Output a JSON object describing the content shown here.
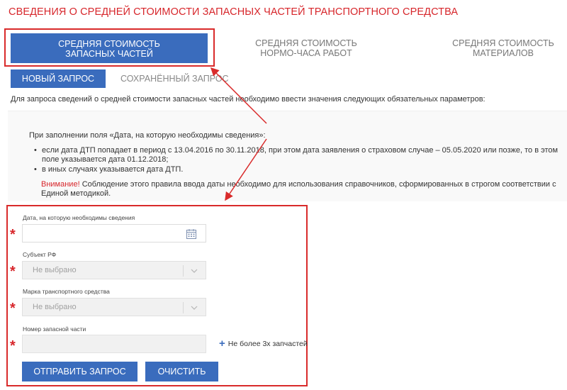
{
  "page": {
    "title": "СВЕДЕНИЯ О СРЕДНЕЙ СТОИМОСТИ ЗАПАСНЫХ ЧАСТЕЙ ТРАНСПОРТНОГО СРЕДСТВА"
  },
  "tabs": [
    {
      "line1": "СРЕДНЯЯ СТОИМОСТЬ",
      "line2": "ЗАПАСНЫХ ЧАСТЕЙ",
      "active": true
    },
    {
      "line1": "СРЕДНЯЯ СТОИМОСТЬ",
      "line2": "НОРМО-ЧАСА РАБОТ",
      "active": false
    },
    {
      "line1": "СРЕДНЯЯ СТОИМОСТЬ",
      "line2": "МАТЕРИАЛОВ",
      "active": false
    }
  ],
  "subtabs": {
    "new_request": "НОВЫЙ ЗАПРОС",
    "saved_request": "СОХРАНЁННЫЙ ЗАПРОС"
  },
  "intro": "Для запроса сведений о средней стоимости запасных частей необходимо ввести значения следующих обязательных параметров:",
  "info": {
    "heading": "При заполнении поля «Дата, на которую необходимы сведения»:",
    "bullets": [
      "если дата ДТП попадает в период с 13.04.2016 по 30.11.2018, при этом дата заявления о страховом случае – 05.05.2020 или позже, то в этом поле указывается дата 01.12.2018;",
      "в иных случаях указывается дата ДТП."
    ],
    "warning_word": "Внимание!",
    "warning_text": " Соблюдение этого правила ввода даты необходимо для использования справочников, сформированных в строгом соответствии с Единой методикой."
  },
  "form": {
    "required_mark": "*",
    "date": {
      "label": "Дата, на которую необходимы сведения",
      "value": "",
      "icon": "calendar-icon"
    },
    "region": {
      "label": "Субъект РФ",
      "selected": "Не выбрано",
      "icon": "chevron-down-icon"
    },
    "brand": {
      "label": "Марка транспортного средства",
      "selected": "Не выбрано",
      "icon": "chevron-down-icon"
    },
    "part_number": {
      "label": "Номер запасной части",
      "value": ""
    },
    "add_part": {
      "icon": "plus-icon",
      "symbol": "+",
      "label": "Не более 3х запчастей"
    },
    "send_button": "ОТПРАВИТЬ ЗАПРОС",
    "clear_button": "ОЧИСТИТЬ"
  },
  "colors": {
    "accent_blue": "#3a6cbd",
    "title_red": "#d7262b",
    "highlight_red": "#d92b2b"
  }
}
